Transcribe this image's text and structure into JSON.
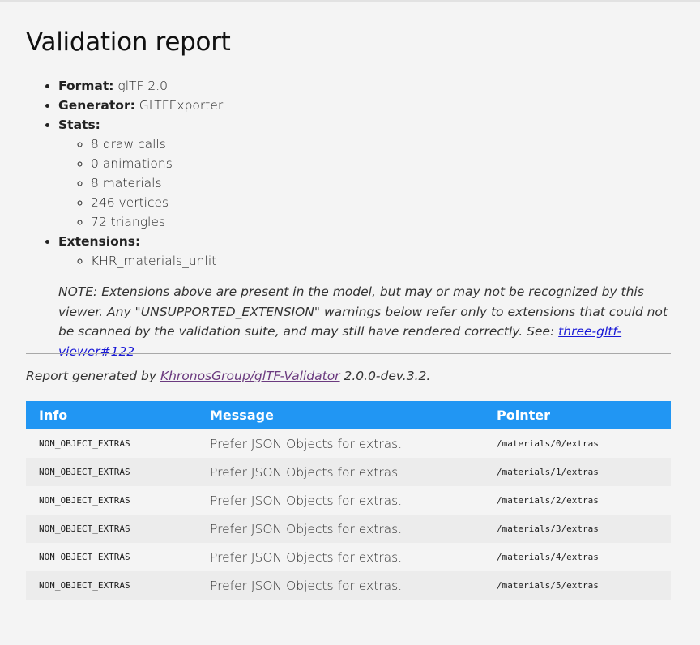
{
  "title": "Validation report",
  "properties": {
    "format_label": "Format:",
    "format_value": "glTF 2.0",
    "generator_label": "Generator:",
    "generator_value": "GLTFExporter",
    "stats_label": "Stats:",
    "stats": [
      "8 draw calls",
      "0 animations",
      "8 materials",
      "246 vertices",
      "72 triangles"
    ],
    "extensions_label": "Extensions:",
    "extensions": [
      "KHR_materials_unlit"
    ]
  },
  "note": {
    "text": "NOTE: Extensions above are present in the model, but may or may not be recognized by this viewer. Any \"UNSUPPORTED_EXTENSION\" warnings below refer only to extensions that could not be scanned by the validation suite, and may still have rendered correctly. See: ",
    "link_text": "three-gltf-viewer#122"
  },
  "generated": {
    "prefix": "Report generated by ",
    "link_text": "KhronosGroup/glTF-Validator",
    "suffix": " 2.0.0-dev.3.2."
  },
  "table": {
    "headers": [
      "Info",
      "Message",
      "Pointer"
    ],
    "rows": [
      {
        "info": "NON_OBJECT_EXTRAS",
        "message": "Prefer JSON Objects for extras.",
        "pointer": "/materials/0/extras"
      },
      {
        "info": "NON_OBJECT_EXTRAS",
        "message": "Prefer JSON Objects for extras.",
        "pointer": "/materials/1/extras"
      },
      {
        "info": "NON_OBJECT_EXTRAS",
        "message": "Prefer JSON Objects for extras.",
        "pointer": "/materials/2/extras"
      },
      {
        "info": "NON_OBJECT_EXTRAS",
        "message": "Prefer JSON Objects for extras.",
        "pointer": "/materials/3/extras"
      },
      {
        "info": "NON_OBJECT_EXTRAS",
        "message": "Prefer JSON Objects for extras.",
        "pointer": "/materials/4/extras"
      },
      {
        "info": "NON_OBJECT_EXTRAS",
        "message": "Prefer JSON Objects for extras.",
        "pointer": "/materials/5/extras"
      }
    ]
  },
  "colors": {
    "header_bg": "#2196f3",
    "page_bg": "#f4f4f4",
    "row_alt_bg": "#ececec",
    "link": "#1a1ad6",
    "link_visited": "#6b3a7f"
  }
}
